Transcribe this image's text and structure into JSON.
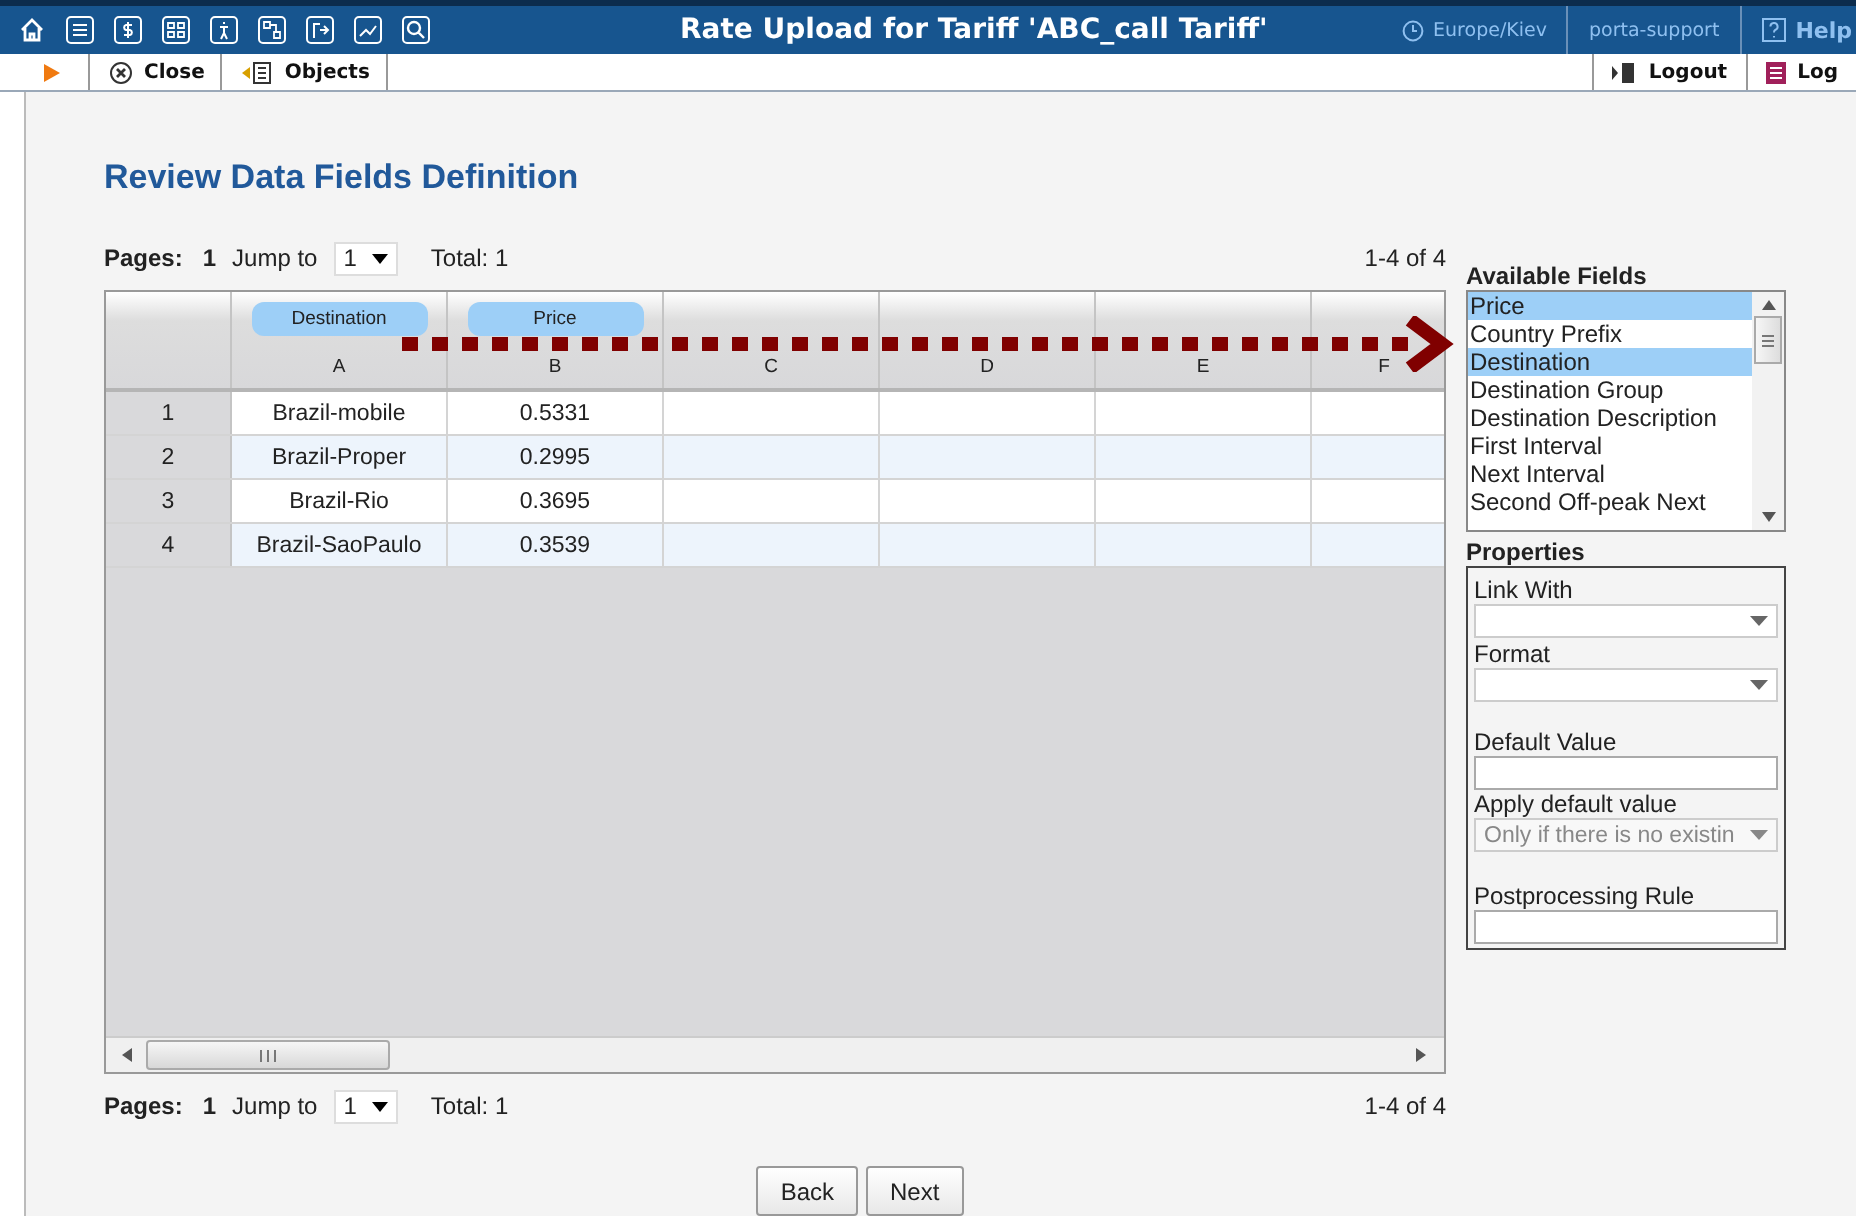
{
  "header": {
    "title": "Rate Upload for Tariff 'ABC_call Tariff'",
    "timezone": "Europe/Kiev",
    "user": "porta-support",
    "help": "Help"
  },
  "toolbar": {
    "left": [
      {
        "label": "Close",
        "kind": "close"
      },
      {
        "label": "Objects",
        "kind": "objects"
      }
    ],
    "right": [
      {
        "label": "Logout",
        "kind": "logout"
      },
      {
        "label": "Log",
        "kind": "log"
      }
    ]
  },
  "heading": "Review Data Fields Definition",
  "pagers": [
    {
      "pages_label": "Pages:",
      "page": "1",
      "jump_label": "Jump to",
      "jump_value": "1",
      "total": "Total: 1",
      "range": "1-4 of 4"
    },
    {
      "pages_label": "Pages:",
      "page": "1",
      "jump_label": "Jump to",
      "jump_value": "1",
      "total": "Total: 1",
      "range": "1-4 of 4"
    }
  ],
  "grid": {
    "columns": [
      {
        "letter": "A",
        "field": "Destination"
      },
      {
        "letter": "B",
        "field": "Price"
      },
      {
        "letter": "C"
      },
      {
        "letter": "D"
      },
      {
        "letter": "E"
      },
      {
        "letter": "F"
      }
    ],
    "rows": [
      {
        "number": "1",
        "cells": [
          "Brazil-mobile",
          "0.5331"
        ]
      },
      {
        "number": "2",
        "cells": [
          "Brazil-Proper",
          "0.2995"
        ]
      },
      {
        "number": "3",
        "cells": [
          "Brazil-Rio",
          "0.3695"
        ]
      },
      {
        "number": "4",
        "cells": [
          "Brazil-SaoPaulo",
          "0.3539"
        ]
      }
    ]
  },
  "available_fields": {
    "title": "Available Fields",
    "items": [
      {
        "label": "Price",
        "selected": true
      },
      {
        "label": "Country Prefix",
        "selected": false
      },
      {
        "label": "Destination",
        "selected": true
      },
      {
        "label": "Destination Group",
        "selected": false
      },
      {
        "label": "Destination Description",
        "selected": false
      },
      {
        "label": "First Interval",
        "selected": false
      },
      {
        "label": "Next Interval",
        "selected": false
      },
      {
        "label": "Second Off-peak Next",
        "selected": false
      }
    ]
  },
  "properties": {
    "title": "Properties",
    "fields": [
      {
        "label": "Link With",
        "kind": "select",
        "disabled": false
      },
      {
        "label": "Format",
        "kind": "select",
        "disabled": false
      },
      {
        "label": "Default Value",
        "kind": "input"
      },
      {
        "label": "Apply default value",
        "kind": "select",
        "value": "Only if there is no existin",
        "disabled": true
      },
      {
        "label": "Postprocessing Rule",
        "kind": "input"
      }
    ]
  },
  "buttons": [
    {
      "label": "Back"
    },
    {
      "label": "Next"
    }
  ]
}
